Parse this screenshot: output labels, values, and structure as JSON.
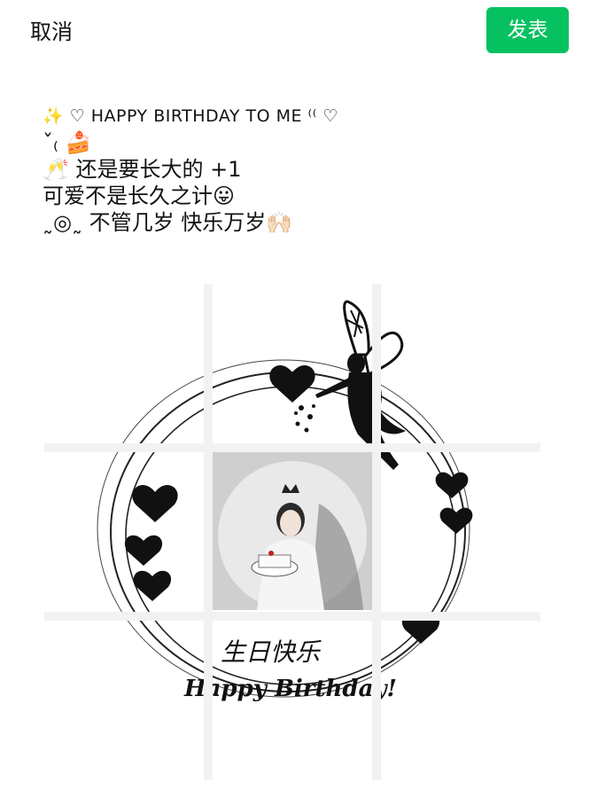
{
  "topbar": {
    "cancel_label": "取消",
    "publish_label": "发表"
  },
  "post": {
    "lines": [
      "✨ ♡ HAPPY BIRTHDAY TO ME ⁽⁽ ♡",
      "ˇ₍ 🍰",
      "🥂 还是要长大的 +1",
      "可爱不是长久之计😛",
      "˷◎˷ 不管几岁 快乐万岁🙌🏻"
    ]
  },
  "image_grid": {
    "artwork_text_cn": "生日快乐",
    "artwork_text_en": "Happy Birthday!"
  },
  "colors": {
    "publish_bg": "#07c160",
    "text": "#111111"
  }
}
